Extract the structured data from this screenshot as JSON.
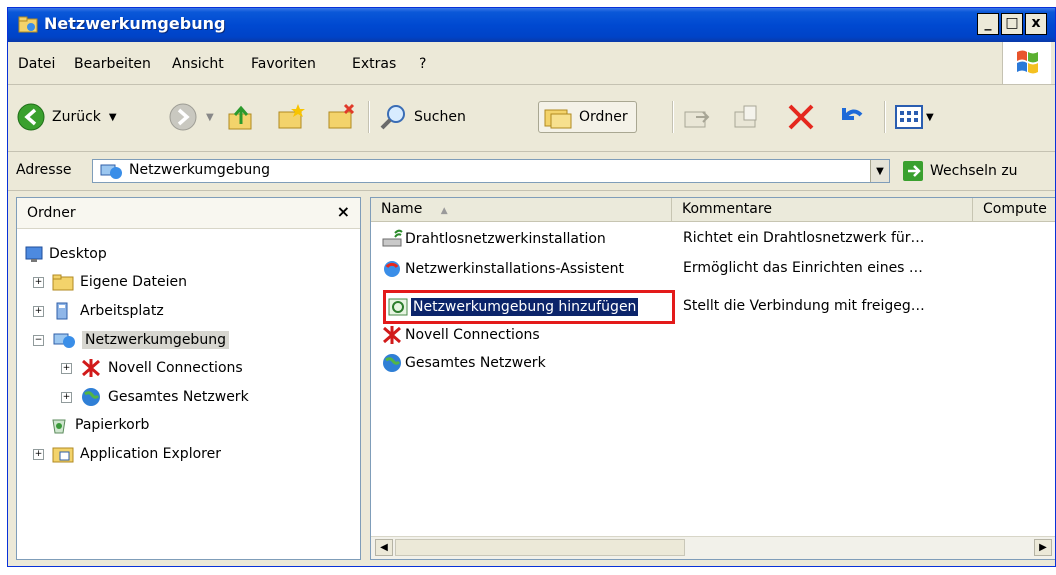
{
  "window": {
    "title": "Netzwerkumgebung",
    "controls": {
      "minimize": "_",
      "maximize": "□",
      "close": "x"
    }
  },
  "menu": [
    {
      "label": "Datei"
    },
    {
      "label": "Bearbeiten"
    },
    {
      "label": "Ansicht"
    },
    {
      "label": "Favoriten"
    },
    {
      "label": "Extras"
    },
    {
      "label": "?"
    }
  ],
  "toolbar": {
    "back_label": "Zurück",
    "search_label": "Suchen",
    "folders_label": "Ordner"
  },
  "address": {
    "label": "Adresse",
    "value": "Netzwerkumgebung",
    "go_label": "Wechseln zu"
  },
  "folders_pane": {
    "title": "Ordner",
    "close": "×",
    "tree": [
      {
        "label": "Desktop",
        "expander": ""
      },
      {
        "label": "Eigene Dateien",
        "expander": "+"
      },
      {
        "label": "Arbeitsplatz",
        "expander": "+"
      },
      {
        "label": "Netzwerkumgebung",
        "expander": "−"
      },
      {
        "label": "Novell Connections",
        "expander": "+"
      },
      {
        "label": "Gesamtes Netzwerk",
        "expander": "+"
      },
      {
        "label": "Papierkorb",
        "expander": ""
      },
      {
        "label": "Application Explorer",
        "expander": "+"
      }
    ]
  },
  "list": {
    "columns": [
      "Name",
      "Kommentare",
      "Compute"
    ],
    "sort_indicator": "▲",
    "items": [
      {
        "name": "Drahtlosnetzwerkinstallation",
        "comment": "Richtet ein Drahtlosnetzwerk für…",
        "icon": "wireless-setup-icon"
      },
      {
        "name": "Netzwerkinstallations-Assistent",
        "comment": "Ermöglicht das Einrichten eines …",
        "icon": "network-wizard-icon"
      },
      {
        "name": "Netzwerkumgebung hinzufügen",
        "comment": "Stellt die Verbindung mit freigeg…",
        "icon": "add-network-place-icon"
      },
      {
        "name": "Novell Connections",
        "comment": "",
        "icon": "novell-icon"
      },
      {
        "name": "Gesamtes Netzwerk",
        "comment": "",
        "icon": "globe-icon"
      }
    ]
  },
  "colors": {
    "titlebar": "#0049d1",
    "highlight_border": "#e31a1a",
    "selection": "#0b246a"
  }
}
